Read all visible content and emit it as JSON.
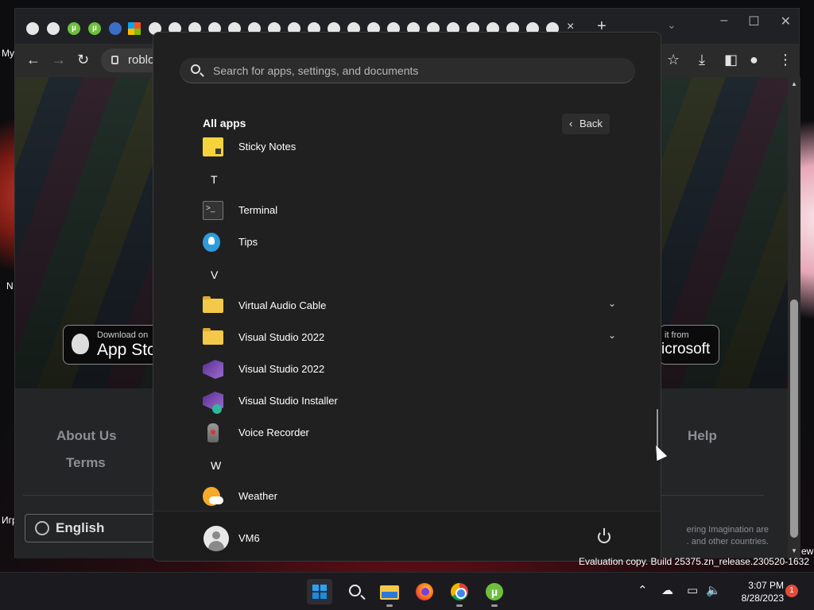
{
  "browser": {
    "address": "roblo",
    "tab_close": "×",
    "tab_new": "+",
    "window_controls": [
      "–",
      "☐",
      "✕"
    ],
    "left_window_fragments": [
      "My",
      "N",
      "Игр"
    ]
  },
  "webpage": {
    "app_store_small": "Download on",
    "app_store_big": "App Sto",
    "ms_store_small": "it from",
    "ms_store_big": "icrosoft",
    "footer_links": [
      "About Us",
      "Terms",
      "Help"
    ],
    "language": "English",
    "fineprint_1": "ering Imagination are",
    "fineprint_2": ". and other countries.",
    "fineprint_3": "ew"
  },
  "start_menu": {
    "search_placeholder": "Search for apps, settings, and documents",
    "section_title": "All apps",
    "back_label": "Back",
    "items": [
      {
        "type": "app",
        "label": "Sticky Notes",
        "icon": "sticky-notes-icon"
      },
      {
        "type": "letter",
        "label": "T"
      },
      {
        "type": "app",
        "label": "Terminal",
        "icon": "terminal-icon"
      },
      {
        "type": "app",
        "label": "Tips",
        "icon": "tips-icon"
      },
      {
        "type": "letter",
        "label": "V"
      },
      {
        "type": "folder",
        "label": "Virtual Audio Cable",
        "icon": "folder-icon"
      },
      {
        "type": "folder",
        "label": "Visual Studio 2022",
        "icon": "folder-icon"
      },
      {
        "type": "app",
        "label": "Visual Studio 2022",
        "icon": "visual-studio-icon"
      },
      {
        "type": "app",
        "label": "Visual Studio Installer",
        "icon": "visual-studio-installer-icon"
      },
      {
        "type": "app",
        "label": "Voice Recorder",
        "icon": "voice-recorder-icon"
      },
      {
        "type": "letter",
        "label": "W"
      },
      {
        "type": "app",
        "label": "Weather",
        "icon": "weather-icon"
      }
    ],
    "user_name": "VM6"
  },
  "watermark": "Evaluation copy. Build 25375.zn_release.230520-1632",
  "taskbar": {
    "time": "3:07 PM",
    "date": "8/28/2023",
    "notification_count": "1"
  }
}
